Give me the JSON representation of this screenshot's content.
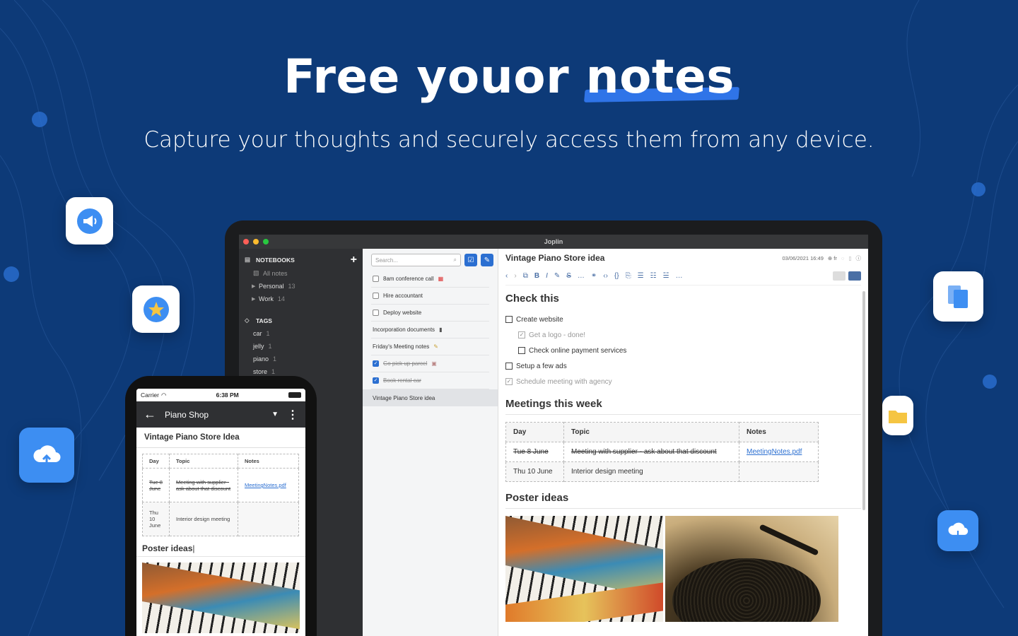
{
  "hero": {
    "title_part1": "Free youor ",
    "title_highlight": "notes",
    "subtitle": "Capture your thoughts and securely access them from any device."
  },
  "floating_icons": [
    {
      "name": "megaphone-icon"
    },
    {
      "name": "star-icon"
    },
    {
      "name": "cloud-upload-icon"
    },
    {
      "name": "files-icon"
    },
    {
      "name": "folder-icon"
    },
    {
      "name": "cloud-download-icon"
    }
  ],
  "desktop": {
    "window_title": "Joplin",
    "sidebar": {
      "notebooks_label": "NOTEBOOKS",
      "all_notes": "All notes",
      "notebooks": [
        {
          "label": "Personal",
          "count": "13"
        },
        {
          "label": "Work",
          "count": "14"
        }
      ],
      "tags_label": "TAGS",
      "tags": [
        {
          "label": "car",
          "count": "1"
        },
        {
          "label": "jelly",
          "count": "1"
        },
        {
          "label": "piano",
          "count": "1"
        },
        {
          "label": "store",
          "count": "1"
        }
      ]
    },
    "note_list": {
      "search_placeholder": "Search...",
      "items": [
        {
          "label": "8am conference call",
          "todo": true,
          "done": false
        },
        {
          "label": "Hire accountant",
          "todo": true,
          "done": false
        },
        {
          "label": "Deploy website",
          "todo": true,
          "done": false
        },
        {
          "label": "Incorporation documents",
          "todo": false,
          "done": false
        },
        {
          "label": "Friday's Meeting notes",
          "todo": false,
          "done": false
        },
        {
          "label": "Go pick up parcel",
          "todo": true,
          "done": true
        },
        {
          "label": "Book rental car",
          "todo": true,
          "done": true
        },
        {
          "label": "Vintage Piano Store idea",
          "todo": false,
          "done": false,
          "selected": true
        }
      ]
    },
    "editor": {
      "title": "Vintage Piano Store idea",
      "datetime": "03/06/2021 16:49",
      "lang": "fr",
      "heading_check": "Check this",
      "checklist": [
        {
          "label": "Create website",
          "checked": false,
          "indent": false
        },
        {
          "label": "Get a logo - done!",
          "checked": true,
          "indent": true
        },
        {
          "label": "Check online payment services",
          "checked": false,
          "indent": true
        },
        {
          "label": "Setup a few ads",
          "checked": false,
          "indent": false
        },
        {
          "label": "Schedule meeting with agency",
          "checked": true,
          "indent": false
        }
      ],
      "heading_meetings": "Meetings this week",
      "table": {
        "headers": [
          "Day",
          "Topic",
          "Notes"
        ],
        "rows": [
          {
            "day": "Tue 8 June",
            "topic": "Meeting with supplier - ask about that discount",
            "notes": "MeetingNotes.pdf",
            "struck": true
          },
          {
            "day": "Thu 10 June",
            "topic": "Interior design meeting",
            "notes": "",
            "struck": false
          }
        ]
      },
      "heading_poster": "Poster ideas"
    }
  },
  "mobile": {
    "carrier": "Carrier",
    "time": "6:38 PM",
    "notebook": "Piano Shop",
    "note_title": "Vintage Piano Store Idea",
    "table": {
      "headers": [
        "Day",
        "Topic",
        "Notes"
      ],
      "rows": [
        {
          "day": "Tue 8 June",
          "topic": "Meeting with supplier - ask about that discount",
          "notes": "MeetingNotes.pdf",
          "struck": true
        },
        {
          "day": "Thu 10 June",
          "topic": "Interior design meeting",
          "notes": "",
          "struck": false
        }
      ]
    },
    "poster_heading": "Poster ideas"
  }
}
